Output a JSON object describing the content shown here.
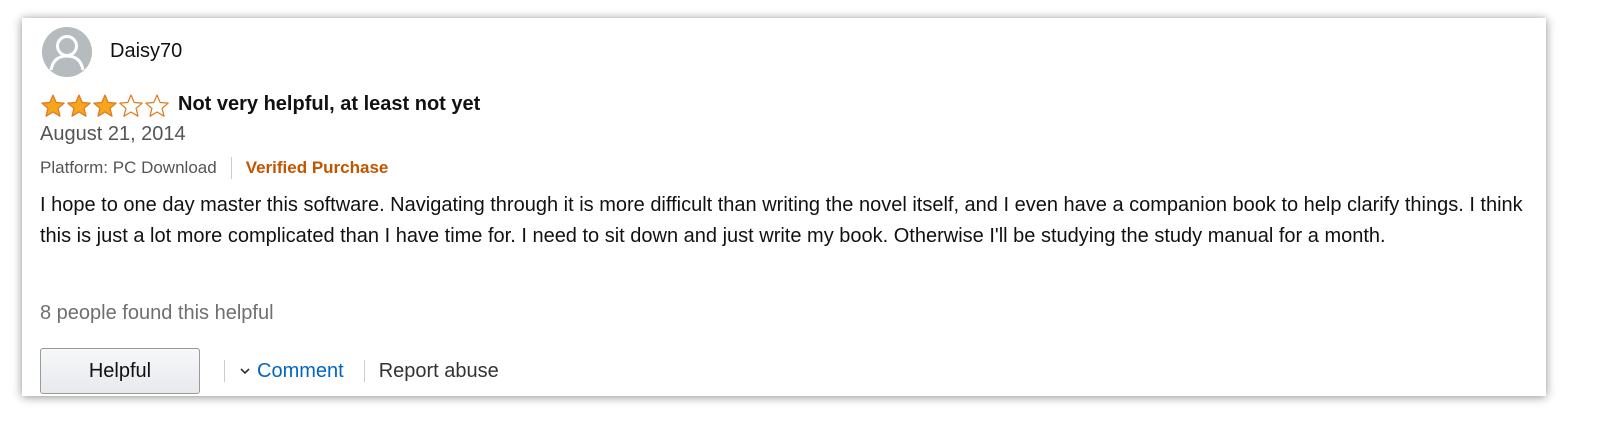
{
  "review": {
    "username": "Daisy70",
    "rating": 3,
    "rating_max": 5,
    "star_color": "#f7a51c",
    "title": "Not very helpful, at least not yet",
    "date": "August 21, 2014",
    "platform": "Platform: PC Download",
    "verified": "Verified Purchase",
    "verified_color": "#c45500",
    "body": "I hope to one day master this software. Navigating through it is more difficult than writing the novel itself, and I even have a companion book to help clarify things. I think this is just a lot more complicated than I have time for. I need to sit down and just write my book. Otherwise I'll be studying the study manual for a month.",
    "helpful_count": "8 people found this helpful"
  },
  "actions": {
    "helpful_label": "Helpful",
    "comment_label": "Comment",
    "report_label": "Report abuse",
    "link_color": "#0066c0"
  },
  "icons": {
    "avatar": "user-avatar-icon",
    "star": "star-icon",
    "comment_toggle": "chevron-down-icon"
  }
}
